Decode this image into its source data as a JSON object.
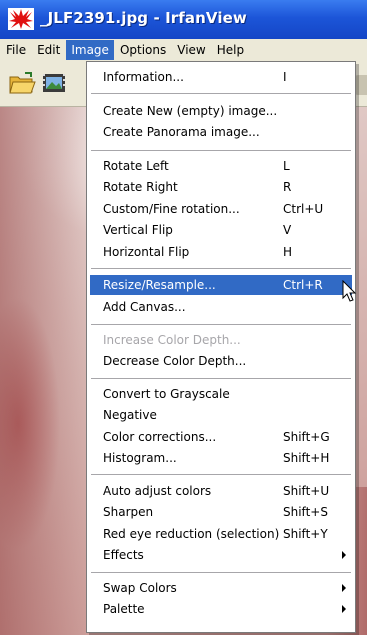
{
  "window": {
    "title": "_JLF2391.jpg - IrfanView",
    "app_icon": "irfanview-red-cat-icon"
  },
  "menubar": {
    "items": [
      "File",
      "Edit",
      "Image",
      "Options",
      "View",
      "Help"
    ],
    "active": "Image"
  },
  "toolbar": {
    "buttons": [
      "open-folder-icon",
      "slideshow-icon"
    ]
  },
  "image_menu": {
    "items": [
      {
        "label": "Information...",
        "shortcut": "I"
      },
      {
        "label": "Create New (empty) image...",
        "shortcut": ""
      },
      {
        "label": "Create Panorama image...",
        "shortcut": ""
      },
      {
        "label": "Rotate Left",
        "shortcut": "L"
      },
      {
        "label": "Rotate Right",
        "shortcut": "R"
      },
      {
        "label": "Custom/Fine rotation...",
        "shortcut": "Ctrl+U"
      },
      {
        "label": "Vertical Flip",
        "shortcut": "V"
      },
      {
        "label": "Horizontal Flip",
        "shortcut": "H"
      },
      {
        "label": "Resize/Resample...",
        "shortcut": "Ctrl+R"
      },
      {
        "label": "Add Canvas...",
        "shortcut": ""
      },
      {
        "label": "Increase Color Depth...",
        "shortcut": ""
      },
      {
        "label": "Decrease Color Depth...",
        "shortcut": ""
      },
      {
        "label": "Convert to Grayscale",
        "shortcut": ""
      },
      {
        "label": "Negative",
        "shortcut": ""
      },
      {
        "label": "Color corrections...",
        "shortcut": "Shift+G"
      },
      {
        "label": "Histogram...",
        "shortcut": "Shift+H"
      },
      {
        "label": "Auto adjust colors",
        "shortcut": "Shift+U"
      },
      {
        "label": "Sharpen",
        "shortcut": "Shift+S"
      },
      {
        "label": "Red eye reduction (selection)",
        "shortcut": "Shift+Y"
      },
      {
        "label": "Effects",
        "shortcut": ""
      },
      {
        "label": "Swap Colors",
        "shortcut": ""
      },
      {
        "label": "Palette",
        "shortcut": ""
      }
    ],
    "highlighted": "Resize/Resample...",
    "disabled": [
      "Increase Color Depth..."
    ],
    "submenus": [
      "Effects",
      "Swap Colors",
      "Palette"
    ]
  },
  "colors": {
    "titlebar": "#1c55d8",
    "menu_highlight": "#316ac5",
    "menu_background": "#ffffff",
    "menubar_background": "#ece9d8",
    "disabled_text": "#a7a6aa"
  }
}
